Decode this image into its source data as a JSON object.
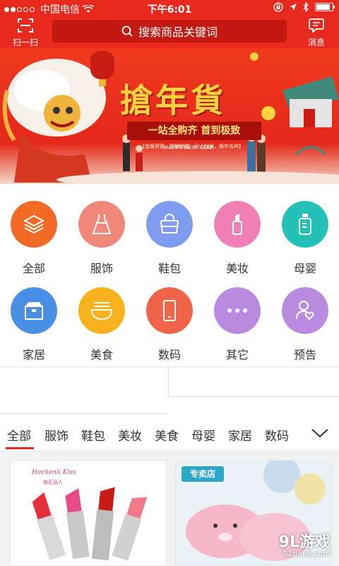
{
  "status_bar": {
    "carrier": "中国电信",
    "time": "下午6:01",
    "signal_dots": 2,
    "battery_level": 0.85
  },
  "header": {
    "scan_label": "扫一扫",
    "search_placeholder": "搜索商品关键词",
    "message_label": "消息"
  },
  "banner": {
    "title": "搶年貨",
    "subtitle": "一站全购齐 首到极致",
    "tags": "【金猴贺春，灵猴献瑞，马上封侯，猴年吉祥】",
    "greeting": "HAPPY NEW YEAR"
  },
  "categories": [
    {
      "label": "全部",
      "icon": "layers-icon",
      "color": "#f26a23"
    },
    {
      "label": "服饰",
      "icon": "dress-icon",
      "color": "#f0887a"
    },
    {
      "label": "鞋包",
      "icon": "handbag-icon",
      "color": "#7f9df0"
    },
    {
      "label": "美妆",
      "icon": "lipstick-icon",
      "color": "#f07fb4"
    },
    {
      "label": "母婴",
      "icon": "baby-bottle-icon",
      "color": "#25c0b6"
    },
    {
      "label": "家居",
      "icon": "box-icon",
      "color": "#4a8fe6"
    },
    {
      "label": "美食",
      "icon": "noodle-bowl-icon",
      "color": "#f6b11c"
    },
    {
      "label": "数码",
      "icon": "phone-icon",
      "color": "#f0654a"
    },
    {
      "label": "其它",
      "icon": "more-icon",
      "color": "#b88ae0"
    },
    {
      "label": "预告",
      "icon": "person-heart-icon",
      "color": "#b88ae0"
    }
  ],
  "tabs": {
    "items": [
      "全部",
      "服饰",
      "鞋包",
      "美妆",
      "美食",
      "母婴",
      "家居",
      "数码"
    ],
    "active": "全部",
    "accent": "#e8291e"
  },
  "products": {
    "left_brand": "Hechenli Kiss",
    "left_sub": "赫臣丽人",
    "right_badge": "专卖店"
  },
  "watermark": {
    "main": "9L游戏",
    "url": "91danji.com"
  },
  "colors": {
    "brand_red": "#e8291e",
    "search_bg": "#c41913"
  }
}
